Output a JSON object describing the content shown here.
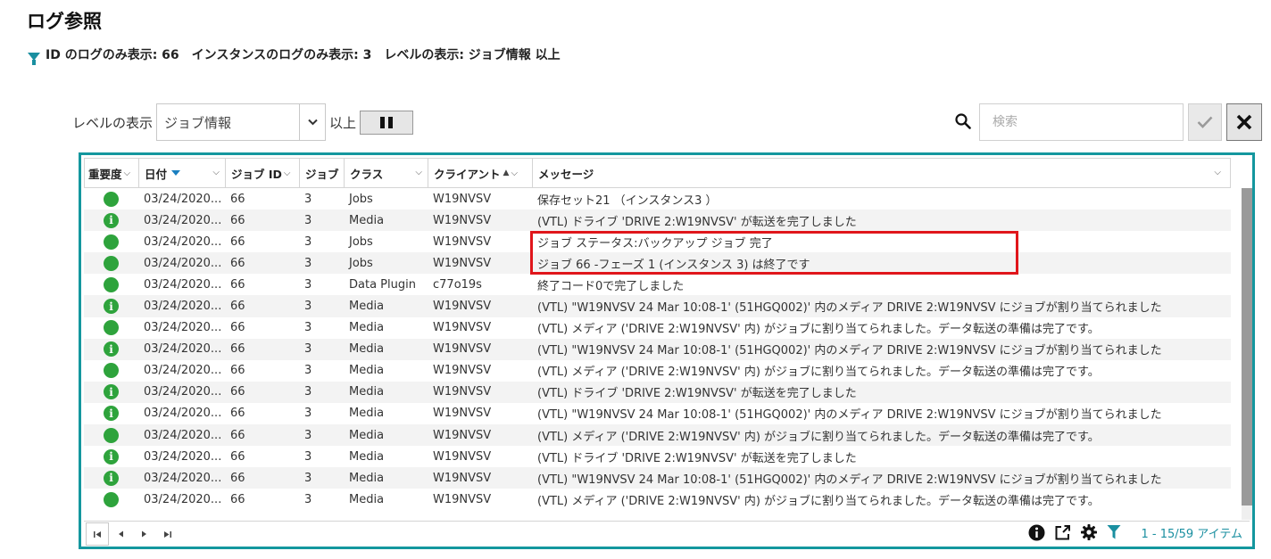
{
  "page": {
    "title": "ログ参照",
    "filters": [
      "ID のログのみ表示: 66",
      "インスタンスのログのみ表示: 3",
      "レベルの表示: ジョブ情報 以上"
    ]
  },
  "toolbar": {
    "level_label": "レベルの表示",
    "level_value": "ジョブ情報",
    "ijo": "以上",
    "search_placeholder": "検索"
  },
  "columns": [
    {
      "label": "重要度"
    },
    {
      "label": "日付"
    },
    {
      "label": "ジョブ ID"
    },
    {
      "label": "ジョブ"
    },
    {
      "label": "クラス"
    },
    {
      "label": "クライアント"
    },
    {
      "label": "メッセージ"
    }
  ],
  "rows": [
    {
      "sev": "ok",
      "date": "03/24/2020...",
      "jobid": "66",
      "inst": "3",
      "cls": "Jobs",
      "client": "W19NVSV",
      "msg": "保存セット21 （インスタンス3 ）"
    },
    {
      "sev": "info",
      "date": "03/24/2020...",
      "jobid": "66",
      "inst": "3",
      "cls": "Media",
      "client": "W19NVSV",
      "msg": "(VTL) ドライブ 'DRIVE 2:W19NVSV' が転送を完了しました"
    },
    {
      "sev": "ok",
      "date": "03/24/2020...",
      "jobid": "66",
      "inst": "3",
      "cls": "Jobs",
      "client": "W19NVSV",
      "msg": "ジョブ ステータス:バックアップ ジョブ 完了"
    },
    {
      "sev": "ok",
      "date": "03/24/2020...",
      "jobid": "66",
      "inst": "3",
      "cls": "Jobs",
      "client": "W19NVSV",
      "msg": "ジョブ 66 -フェーズ 1 (インスタンス 3) は終了です"
    },
    {
      "sev": "ok",
      "date": "03/24/2020...",
      "jobid": "66",
      "inst": "3",
      "cls": "Data Plugin",
      "client": "c77o19s",
      "msg": "終了コード0で完了しました"
    },
    {
      "sev": "info",
      "date": "03/24/2020...",
      "jobid": "66",
      "inst": "3",
      "cls": "Media",
      "client": "W19NVSV",
      "msg": "(VTL) \"W19NVSV 24 Mar 10:08-1' (51HGQ002)' 内のメディア DRIVE 2:W19NVSV にジョブが割り当てられました"
    },
    {
      "sev": "ok",
      "date": "03/24/2020...",
      "jobid": "66",
      "inst": "3",
      "cls": "Media",
      "client": "W19NVSV",
      "msg": "(VTL) メディア ('DRIVE 2:W19NVSV' 内) がジョブに割り当てられました。データ転送の準備は完了です。"
    },
    {
      "sev": "info",
      "date": "03/24/2020...",
      "jobid": "66",
      "inst": "3",
      "cls": "Media",
      "client": "W19NVSV",
      "msg": "(VTL) \"W19NVSV 24 Mar 10:08-1' (51HGQ002)' 内のメディア DRIVE 2:W19NVSV にジョブが割り当てられました"
    },
    {
      "sev": "ok",
      "date": "03/24/2020...",
      "jobid": "66",
      "inst": "3",
      "cls": "Media",
      "client": "W19NVSV",
      "msg": "(VTL) メディア ('DRIVE 2:W19NVSV' 内) がジョブに割り当てられました。データ転送の準備は完了です。"
    },
    {
      "sev": "info",
      "date": "03/24/2020...",
      "jobid": "66",
      "inst": "3",
      "cls": "Media",
      "client": "W19NVSV",
      "msg": "(VTL) ドライブ 'DRIVE 2:W19NVSV' が転送を完了しました"
    },
    {
      "sev": "info",
      "date": "03/24/2020...",
      "jobid": "66",
      "inst": "3",
      "cls": "Media",
      "client": "W19NVSV",
      "msg": "(VTL) \"W19NVSV 24 Mar 10:08-1' (51HGQ002)' 内のメディア DRIVE 2:W19NVSV にジョブが割り当てられました"
    },
    {
      "sev": "ok",
      "date": "03/24/2020...",
      "jobid": "66",
      "inst": "3",
      "cls": "Media",
      "client": "W19NVSV",
      "msg": "(VTL) メディア ('DRIVE 2:W19NVSV' 内) がジョブに割り当てられました。データ転送の準備は完了です。"
    },
    {
      "sev": "info",
      "date": "03/24/2020...",
      "jobid": "66",
      "inst": "3",
      "cls": "Media",
      "client": "W19NVSV",
      "msg": "(VTL) ドライブ 'DRIVE 2:W19NVSV' が転送を完了しました"
    },
    {
      "sev": "info",
      "date": "03/24/2020...",
      "jobid": "66",
      "inst": "3",
      "cls": "Media",
      "client": "W19NVSV",
      "msg": "(VTL) \"W19NVSV 24 Mar 10:08-1' (51HGQ002)' 内のメディア DRIVE 2:W19NVSV にジョブが割り当てられました"
    },
    {
      "sev": "ok",
      "date": "03/24/2020...",
      "jobid": "66",
      "inst": "3",
      "cls": "Media",
      "client": "W19NVSV",
      "msg": "(VTL) メディア ('DRIVE 2:W19NVSV' 内) がジョブに割り当てられました。データ転送の準備は完了です。"
    }
  ],
  "pager": {
    "item_count": "1 - 15/59 アイテム"
  },
  "icons": {
    "severity_ok": "green-circle-icon",
    "severity_info": "info-circle-icon",
    "filter": "funnel-icon",
    "search": "search-icon",
    "apply": "checkmark-icon",
    "close": "close-icon",
    "pause": "pause-icon",
    "details": "info-icon",
    "export": "export-icon",
    "settings": "gear-icon"
  },
  "colors": {
    "accent": "#1a8fa0",
    "grid_border": "#14979e",
    "severity": "#2ea33c",
    "highlight": "#e0161b"
  }
}
